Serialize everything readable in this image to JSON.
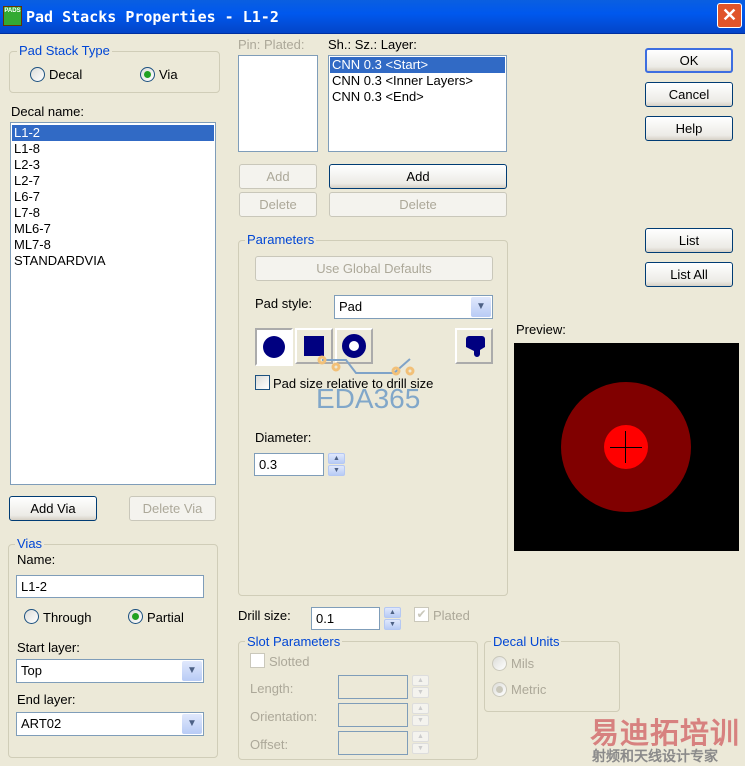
{
  "window": {
    "title": "Pad Stacks Properties - L1-2",
    "logo_text": "PADS"
  },
  "pad_stack_type": {
    "legend": "Pad Stack Type",
    "options": [
      "Decal",
      "Via"
    ],
    "selected": "Via"
  },
  "decal_name": {
    "label": "Decal name:",
    "items": [
      "L1-2",
      "L1-8",
      "L2-3",
      "L2-7",
      "L6-7",
      "L7-8",
      "ML6-7",
      "ML7-8",
      "STANDARDVIA"
    ],
    "selected": "L1-2"
  },
  "buttons": {
    "add_via": "Add Via",
    "delete_via": "Delete Via",
    "add_pin": "Add",
    "delete_pin": "Delete",
    "add_layer": "Add",
    "delete_layer": "Delete",
    "ok": "OK",
    "cancel": "Cancel",
    "help": "Help",
    "list": "List",
    "list_all": "List All",
    "use_global": "Use Global Defaults"
  },
  "vias": {
    "legend": "Vias",
    "name_label": "Name:",
    "name_value": "L1-2",
    "through": "Through",
    "partial": "Partial",
    "selected": "Partial",
    "start_label": "Start layer:",
    "start_value": "Top",
    "end_label": "End layer:",
    "end_value": "ART02"
  },
  "pin_plated": {
    "label": "Pin: Plated:"
  },
  "layers": {
    "header": "Sh.: Sz.: Layer:",
    "items": [
      "CNN 0.3 <Start>",
      "CNN 0.3 <Inner Layers>",
      "CNN 0.3 <End>"
    ],
    "selected": "CNN 0.3 <Start>"
  },
  "parameters": {
    "legend": "Parameters",
    "pad_style_label": "Pad style:",
    "pad_style_value": "Pad",
    "relative_label": "Pad size relative to drill size",
    "relative_checked": false,
    "diameter_label": "Diameter:",
    "diameter_value": "0.3",
    "shapes": [
      "round",
      "square",
      "annular",
      "odd"
    ]
  },
  "drill": {
    "label": "Drill size:",
    "value": "0.1",
    "plated_label": "Plated",
    "plated_checked": true
  },
  "slot": {
    "legend": "Slot Parameters",
    "slotted": "Slotted",
    "length": "Length:",
    "orientation": "Orientation:",
    "offset": "Offset:"
  },
  "units": {
    "legend": "Decal Units",
    "mils": "Mils",
    "metric": "Metric",
    "selected": "Metric"
  },
  "preview": {
    "label": "Preview:",
    "outer_color": "#800000",
    "inner_color": "#FF0000"
  },
  "watermarks": {
    "eda": "EDA365",
    "cn_title": "易迪拓培训",
    "cn_sub": "射频和天线设计专家"
  }
}
